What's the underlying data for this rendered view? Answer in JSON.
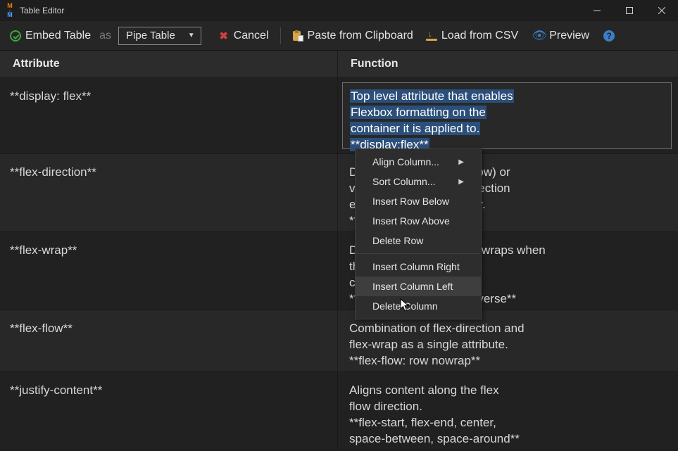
{
  "window": {
    "title": "Table Editor"
  },
  "toolbar": {
    "embed_label": "Embed Table",
    "as_label": "as",
    "table_type_select": {
      "selected": "Pipe Table"
    },
    "cancel_label": "Cancel",
    "paste_label": "Paste from Clipboard",
    "load_csv_label": "Load from CSV",
    "preview_label": "Preview"
  },
  "table": {
    "columns": [
      {
        "header": "Attribute"
      },
      {
        "header": "Function"
      }
    ],
    "rows": [
      {
        "attribute": "**display: flex**",
        "function_": "Top level attribute that enables Flexbox formatting on the container it is applied to. **display:flex**",
        "function_lines": [
          "Top level attribute that enables",
          "Flexbox formatting on the",
          "container it is applied to.",
          "**display:flex**"
        ],
        "editing": true,
        "selected": true
      },
      {
        "attribute": "**flex-direction**",
        "function_": "Determines horizontal (row) or vertical (column) flow direction elements in the container. **row, column**"
      },
      {
        "attribute": "**flex-wrap**",
        "function_": "Determines how content wraps when the content overflows the container. **wrap, nowrap, wrap-reverse**"
      },
      {
        "attribute": "**flex-flow**",
        "function_": "Combination of flex-direction and flex-wrap as a single attribute.\n**flex-flow: row nowrap**"
      },
      {
        "attribute": "**justify-content**",
        "function_": "Aligns content along the flex flow direction.\n**flex-start, flex-end, center, space-between, space-around**"
      }
    ]
  },
  "context_menu": {
    "items": [
      {
        "label": "Align Column...",
        "submenu": true
      },
      {
        "label": "Sort Column...",
        "submenu": true
      },
      {
        "label": "Insert Row Below"
      },
      {
        "label": "Insert Row Above"
      },
      {
        "label": "Delete Row"
      },
      {
        "separator": true
      },
      {
        "label": "Insert Column Right"
      },
      {
        "label": "Insert Column Left",
        "hover": true
      },
      {
        "label": "Delete Column"
      }
    ]
  },
  "colors": {
    "accent_blue": "#3a7fc4",
    "accent_green": "#3fa63f",
    "accent_red": "#d04040",
    "accent_amber": "#d9a441",
    "selection_bg": "#2b4f7a"
  }
}
